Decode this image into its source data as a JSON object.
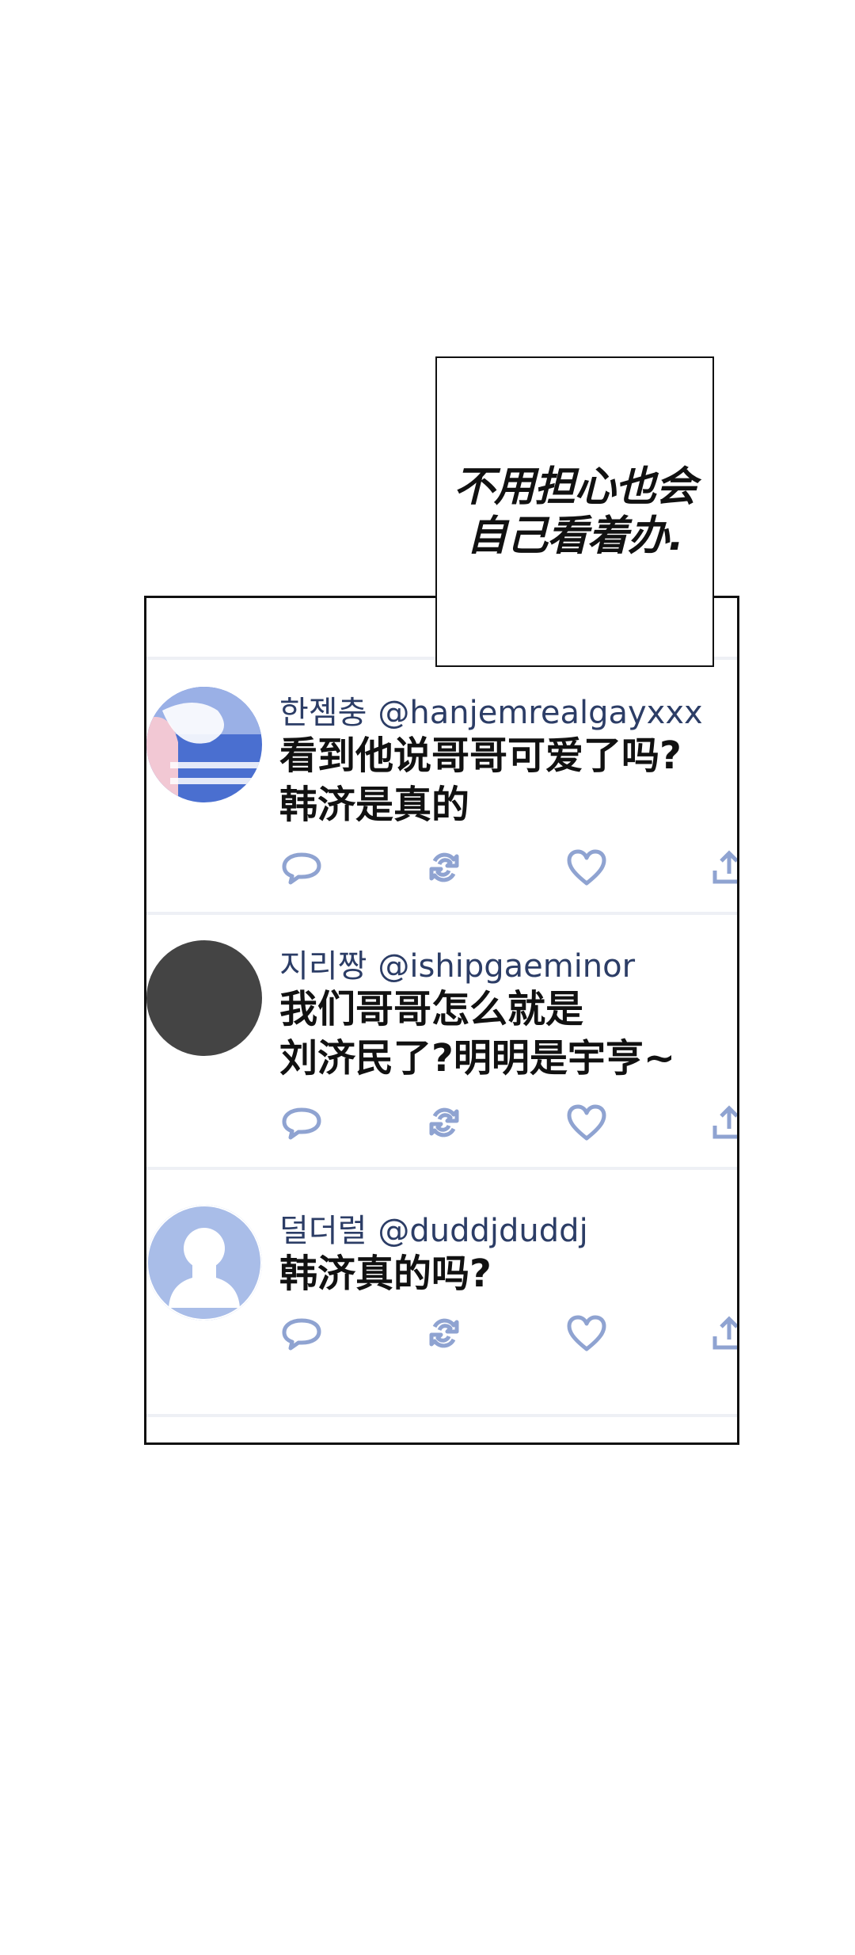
{
  "caption": {
    "text": "不用担心也会\n自己看着办."
  },
  "tweets": [
    {
      "name": "한젬충",
      "handle": "@hanjemrealgayxxx",
      "text": "看到他说哥哥可爱了吗?\n韩济是真的"
    },
    {
      "name": "지리짱",
      "handle": "@ishipgaeminor",
      "text": "我们哥哥怎么就是\n刘济民了?明明是宇亨~"
    },
    {
      "name": "덜더럴",
      "handle": "@duddjduddj",
      "text": "韩济真的吗?"
    }
  ],
  "icons": [
    "reply-icon",
    "retweet-icon",
    "like-icon",
    "share-icon"
  ],
  "colors": {
    "icon": "#8fa3d1",
    "name": "#2c3d66",
    "divider": "#eef0f5"
  }
}
